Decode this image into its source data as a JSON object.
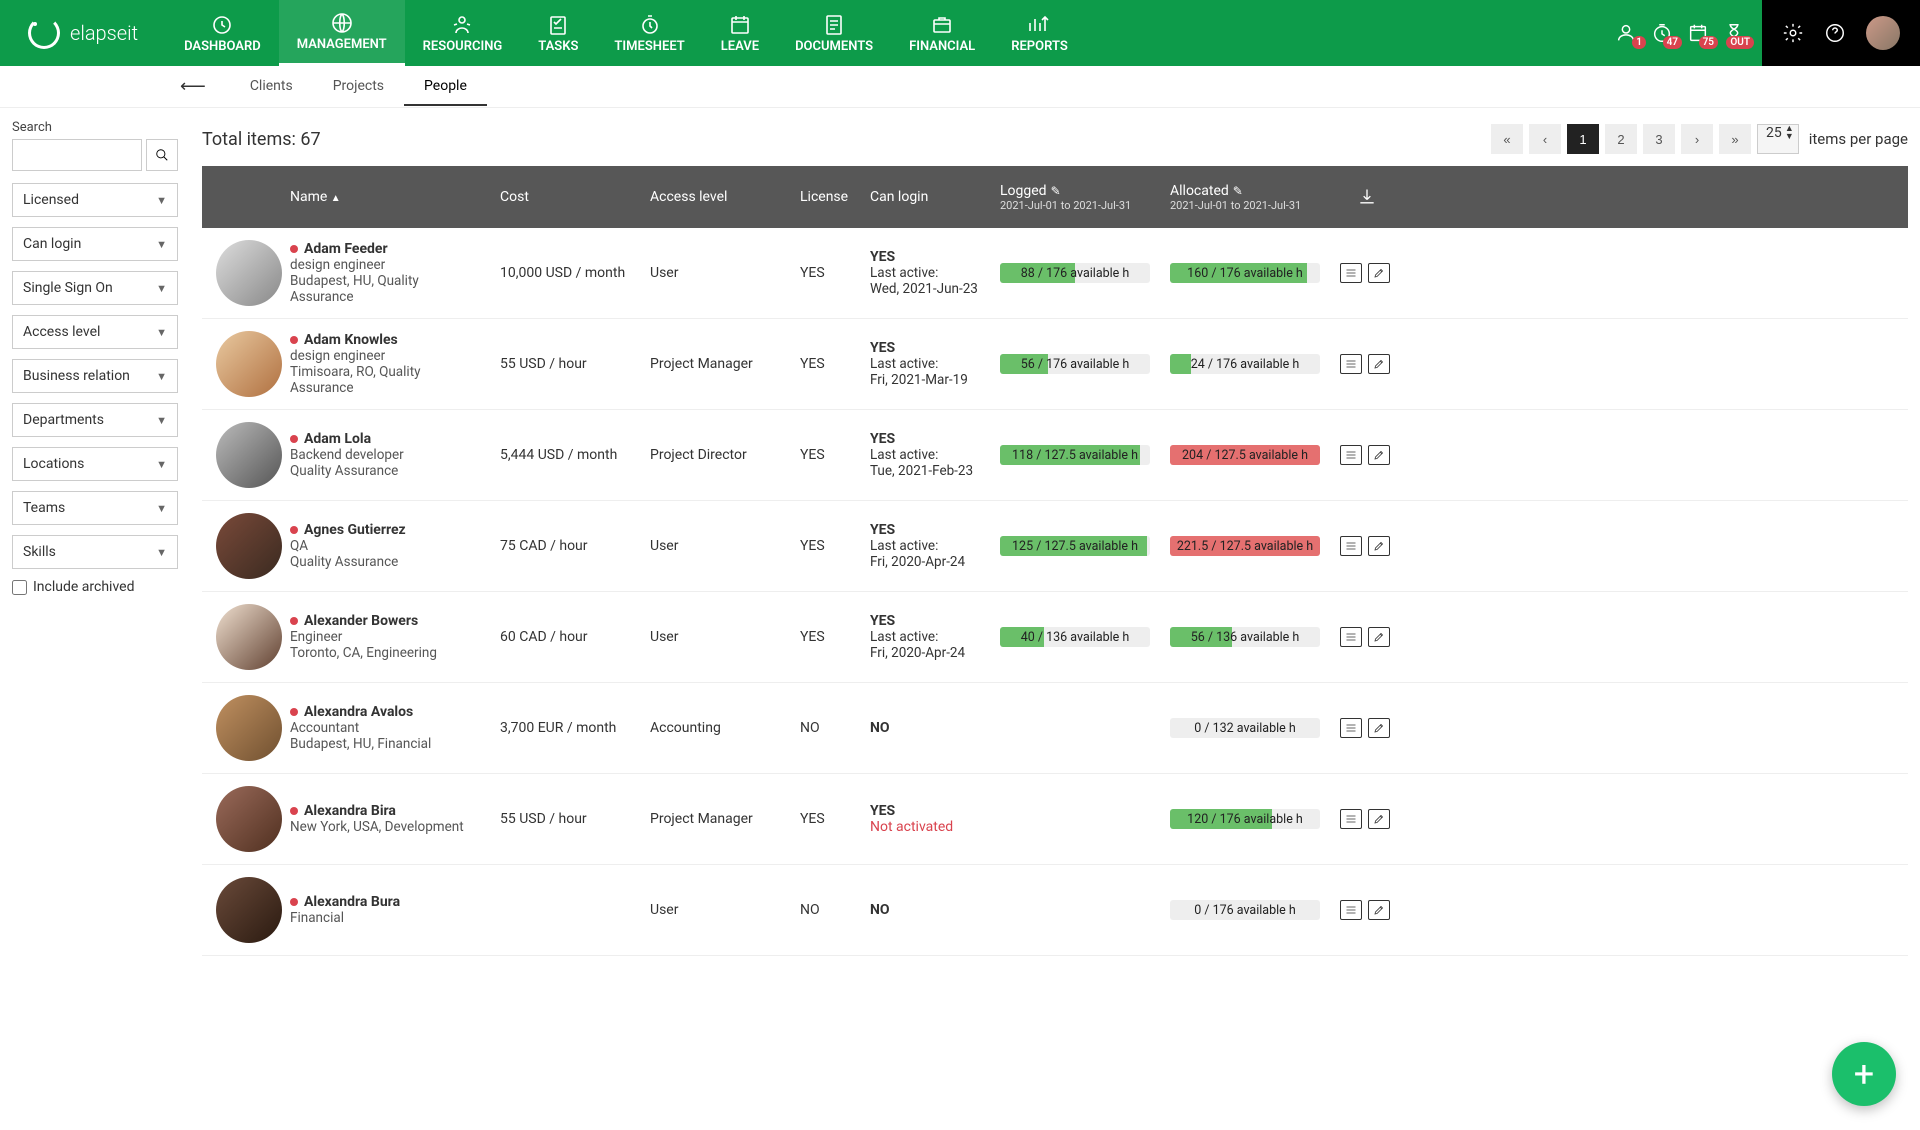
{
  "brand": "elapseit",
  "nav": [
    {
      "label": "DASHBOARD"
    },
    {
      "label": "MANAGEMENT"
    },
    {
      "label": "RESOURCING"
    },
    {
      "label": "TASKS"
    },
    {
      "label": "TIMESHEET"
    },
    {
      "label": "LEAVE"
    },
    {
      "label": "DOCUMENTS"
    },
    {
      "label": "FINANCIAL"
    },
    {
      "label": "REPORTS"
    }
  ],
  "nav_active_index": 1,
  "status_badges": [
    "1",
    "47",
    "75",
    "OUT"
  ],
  "subnav": {
    "items": [
      "Clients",
      "Projects",
      "People"
    ],
    "active_index": 2
  },
  "sidebar": {
    "search_label": "Search",
    "filters": [
      "Licensed",
      "Can login",
      "Single Sign On",
      "Access level",
      "Business relation",
      "Departments",
      "Locations",
      "Teams",
      "Skills"
    ],
    "include_archived": "Include archived"
  },
  "totals": {
    "label": "Total items: 67"
  },
  "pagination": {
    "pages": [
      "«",
      "‹",
      "1",
      "2",
      "3",
      "›",
      "»"
    ],
    "active_index": 2,
    "per_page": "25",
    "per_page_label": "items per page"
  },
  "columns": {
    "name": "Name",
    "cost": "Cost",
    "access": "Access level",
    "license": "License",
    "can_login": "Can login",
    "logged": "Logged",
    "logged_range": "2021-Jul-01 to 2021-Jul-31",
    "allocated": "Allocated",
    "allocated_range": "2021-Jul-01 to 2021-Jul-31"
  },
  "rows": [
    {
      "name": "Adam Feeder",
      "role": "design engineer",
      "loc": "Budapest, HU, Quality Assurance",
      "cost": "10,000 USD / month",
      "access": "User",
      "license": "YES",
      "login": "YES",
      "last_label": "Last active:",
      "last": "Wed, 2021-Jun-23",
      "logged": {
        "text": "88 / 176 available h",
        "pct": 50,
        "color": "green"
      },
      "alloc": {
        "text": "160 / 176 available h",
        "pct": 91,
        "color": "green"
      }
    },
    {
      "name": "Adam Knowles",
      "role": "design engineer",
      "loc": "Timisoara, RO, Quality Assurance",
      "cost": "55 USD / hour",
      "access": "Project Manager",
      "license": "YES",
      "login": "YES",
      "last_label": "Last active:",
      "last": "Fri, 2021-Mar-19",
      "logged": {
        "text": "56 / 176 available h",
        "pct": 32,
        "color": "green"
      },
      "alloc": {
        "text": "24 / 176 available h",
        "pct": 14,
        "color": "green"
      }
    },
    {
      "name": "Adam Lola",
      "role": "Backend developer",
      "loc": "Quality Assurance",
      "cost": "5,444 USD / month",
      "access": "Project Director",
      "license": "YES",
      "login": "YES",
      "last_label": "Last active:",
      "last": "Tue, 2021-Feb-23",
      "logged": {
        "text": "118 / 127.5 available h",
        "pct": 93,
        "color": "green"
      },
      "alloc": {
        "text": "204 / 127.5 available h",
        "pct": 100,
        "color": "red"
      }
    },
    {
      "name": "Agnes Gutierrez",
      "role": "QA",
      "loc": "Quality Assurance",
      "cost": "75 CAD / hour",
      "access": "User",
      "license": "YES",
      "login": "YES",
      "last_label": "Last active:",
      "last": "Fri, 2020-Apr-24",
      "logged": {
        "text": "125 / 127.5 available h",
        "pct": 98,
        "color": "green"
      },
      "alloc": {
        "text": "221.5 / 127.5 available h",
        "pct": 100,
        "color": "red"
      }
    },
    {
      "name": "Alexander Bowers",
      "role": "Engineer",
      "loc": "Toronto, CA, Engineering",
      "cost": "60 CAD / hour",
      "access": "User",
      "license": "YES",
      "login": "YES",
      "last_label": "Last active:",
      "last": "Fri, 2020-Apr-24",
      "logged": {
        "text": "40 / 136 available h",
        "pct": 29,
        "color": "green"
      },
      "alloc": {
        "text": "56 / 136 available h",
        "pct": 41,
        "color": "green"
      }
    },
    {
      "name": "Alexandra Avalos",
      "role": "Accountant",
      "loc": "Budapest, HU, Financial",
      "cost": "3,700 EUR / month",
      "access": "Accounting",
      "license": "NO",
      "login": "NO",
      "last_label": "",
      "last": "",
      "logged": null,
      "alloc": {
        "text": "0 / 132 available h",
        "pct": 0,
        "color": "green"
      }
    },
    {
      "name": "Alexandra Bira",
      "role": "New York, USA, Development",
      "loc": "",
      "cost": "55 USD / hour",
      "access": "Project Manager",
      "license": "YES",
      "login": "YES",
      "last_label": "",
      "last": "Not activated",
      "not_activated": true,
      "logged": null,
      "alloc": {
        "text": "120 / 176 available h",
        "pct": 68,
        "color": "green"
      }
    },
    {
      "name": "Alexandra Bura",
      "role": "Financial",
      "loc": "",
      "cost": "",
      "access": "User",
      "license": "NO",
      "login": "NO",
      "last_label": "",
      "last": "",
      "logged": null,
      "alloc": {
        "text": "0 / 176 available h",
        "pct": 0,
        "color": "green"
      }
    }
  ]
}
